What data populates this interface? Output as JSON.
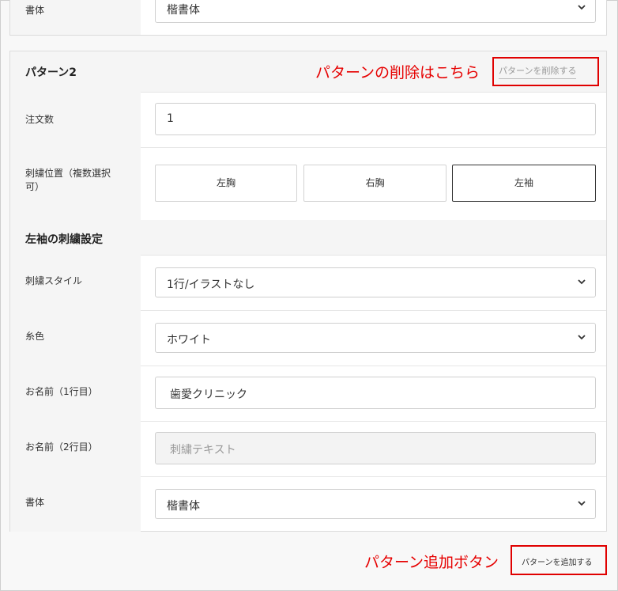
{
  "top_partial": {
    "font_label": "書体",
    "font_value": "楷書体"
  },
  "pattern": {
    "title": "パターン2",
    "delete_button": "パターンを削除する",
    "order_count": {
      "label": "注文数",
      "value": "1"
    },
    "position": {
      "label_line1": "刺繍位置（複数選択",
      "label_line2": "可）",
      "options": [
        "左胸",
        "右胸",
        "左袖"
      ],
      "selected": "左袖"
    },
    "section_title": "左袖の刺繍設定",
    "style": {
      "label": "刺繍スタイル",
      "value": "1行/イラストなし"
    },
    "thread_color": {
      "label": "糸色",
      "value": "ホワイト"
    },
    "name1": {
      "label": "お名前（1行目）",
      "value": "歯愛クリニック"
    },
    "name2": {
      "label": "お名前（2行目）",
      "placeholder": "刺繍テキスト"
    },
    "font": {
      "label": "書体",
      "value": "楷書体"
    }
  },
  "add_button": "パターンを追加する",
  "annotations": {
    "delete_note": "パターンの削除はこちら",
    "add_note": "パターン追加ボタン",
    "highlight_color": "#e60000"
  }
}
